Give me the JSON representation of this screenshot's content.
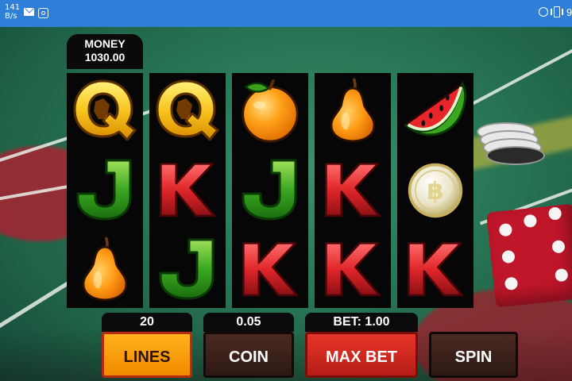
{
  "status_bar": {
    "network_speed_value": "141",
    "network_speed_unit": "B/s",
    "left_icons": [
      "mail-icon",
      "instagram-icon"
    ],
    "right_icons": [
      "alarm-icon",
      "vibrate-icon"
    ],
    "trailing_glyph": "9"
  },
  "money": {
    "label": "MONEY",
    "value": "1030.00"
  },
  "reels": [
    [
      "letter-q-symbol",
      "letter-j-symbol",
      "pear-symbol"
    ],
    [
      "letter-q-symbol",
      "letter-k-symbol",
      "letter-j-symbol"
    ],
    [
      "orange-symbol",
      "letter-j-symbol",
      "letter-k-symbol"
    ],
    [
      "pear-symbol",
      "letter-k-symbol",
      "letter-k-symbol"
    ],
    [
      "watermelon-symbol",
      "bitcoin-coin-symbol",
      "letter-k-symbol"
    ]
  ],
  "controls": {
    "lines_value": "20",
    "lines_label": "LINES",
    "coin_value": "0.05",
    "coin_label": "COIN",
    "bet_value": "BET: 1.00",
    "max_bet_label": "MAX BET",
    "spin_label": "SPIN"
  },
  "colors": {
    "status_bar": "#2f7fd8",
    "reel_bg": "#060606",
    "lines_button": "#f5a10a",
    "max_bet_button": "#d62a20",
    "dark_button": "#3a201a"
  }
}
